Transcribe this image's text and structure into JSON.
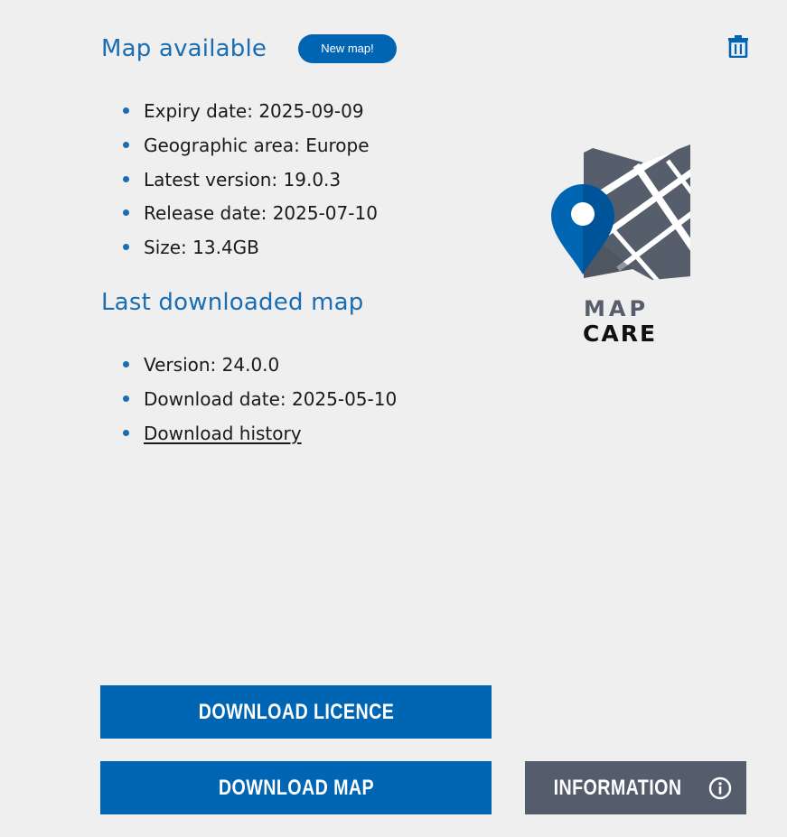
{
  "map_available": {
    "title": "Map available",
    "badge": "New map!",
    "items": [
      "Expiry date: 2025-09-09",
      "Geographic area: Europe",
      "Latest version: 19.0.3",
      "Release date: 2025-07-10",
      "Size: 13.4GB"
    ]
  },
  "last_downloaded": {
    "title": "Last downloaded map",
    "items": [
      "Version: 24.0.0",
      "Download date: 2025-05-10"
    ],
    "history_link": "Download history"
  },
  "logo": {
    "line1": "MAP",
    "line2": "CARE"
  },
  "buttons": {
    "download_licence": "DOWNLOAD LICENCE",
    "download_map": "DOWNLOAD MAP",
    "information": "INFORMATION"
  },
  "icons": {
    "delete": "trash-icon",
    "info": "info-circle-icon",
    "pin": "map-pin-icon"
  },
  "colors": {
    "accent": "#0065b3",
    "title": "#1a6db3",
    "secondary_button": "#535d6b",
    "background": "#efeff0"
  }
}
